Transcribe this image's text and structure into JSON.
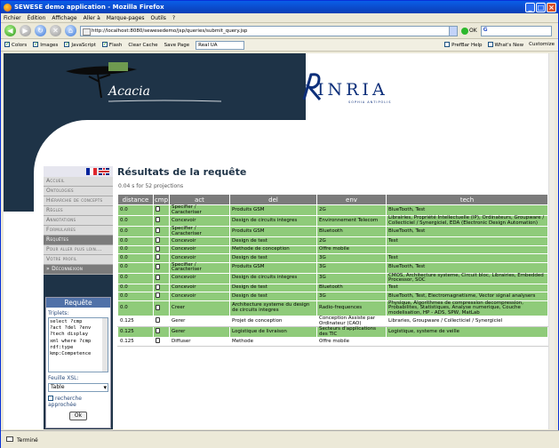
{
  "window": {
    "title": "SEWESE demo application - Mozilla Firefox"
  },
  "menu": [
    "Fichier",
    "Édition",
    "Affichage",
    "Aller à",
    "Marque-pages",
    "Outils",
    "?"
  ],
  "nav": {
    "url": "http://localhost:8080/sewesedemo/jsp/queries/submit_query.jsp",
    "go": "OK",
    "search_value": "G"
  },
  "webdev": {
    "colors": "Colors",
    "images": "Images",
    "javascript": "JavaScript",
    "flash": "Flash",
    "clear_cache": "Clear Cache",
    "save_page": "Save Page",
    "ua_select": "Real UA",
    "prefbar_help": "PrefBar Help",
    "whats_new": "What's New",
    "customize": "Customize"
  },
  "header": {
    "acacia": "Acacia",
    "inria": "INRIA",
    "inria_sub": "SOPHIA ANTIPOLIS"
  },
  "sidebar": {
    "items": [
      "Accueil",
      "Ontologies",
      "Hiérarchie de concepts",
      "Règles",
      "Annotations",
      "Formulaires",
      "Requêtes",
      "Pour aller plus loin...",
      "Votre profil",
      "» Déconnexion"
    ],
    "request_title": "Requête",
    "triplets_label": "Triplets:",
    "triplets": "select ?cmp\n?act ?del ?env\n?tech display\nxml where ?cmp\nrdf:type\nkmp:Competence",
    "xsl_label": "Feuille XSL:",
    "xsl_value": "Table",
    "approx_label": "recherche approchée",
    "ok": "Ok"
  },
  "main": {
    "title": "Résultats de la requête",
    "time": "0.04 s for 52 projections",
    "headers": [
      "distance",
      "cmp",
      "act",
      "del",
      "env",
      "tech"
    ],
    "rows": [
      {
        "c": "g",
        "d": "0.0",
        "act": "Specifier / Caracteriser",
        "del": "Produits GSM",
        "env": "2G",
        "tech": "BlueTooth, Test"
      },
      {
        "c": "g",
        "d": "0.0",
        "act": "Concevoir",
        "del": "Design de circuits integres",
        "env": "Environnement Telecom",
        "tech": "Librairies, Propriété Intellectuelle (IP), Ordinateurs, Groupware / Collecticiel / Synergiciel, EDA (Electronic Design Automation)"
      },
      {
        "c": "g",
        "d": "0.0",
        "act": "Specifier / Caracteriser",
        "del": "Produits GSM",
        "env": "Bluetooth",
        "tech": "BlueTooth, Test"
      },
      {
        "c": "g",
        "d": "0.0",
        "act": "Concevoir",
        "del": "Design de test",
        "env": "2G",
        "tech": "Test"
      },
      {
        "c": "g",
        "d": "0.0",
        "act": "Concevoir",
        "del": "Methode de conception",
        "env": "Offre mobile",
        "tech": ""
      },
      {
        "c": "g",
        "d": "0.0",
        "act": "Concevoir",
        "del": "Design de test",
        "env": "3G",
        "tech": "Test"
      },
      {
        "c": "g",
        "d": "0.0",
        "act": "Specifier / Caracteriser",
        "del": "Produits GSM",
        "env": "3G",
        "tech": "BlueTooth, Test"
      },
      {
        "c": "g",
        "d": "0.0",
        "act": "Concevoir",
        "del": "Design de circuits integres",
        "env": "3G",
        "tech": "CMOS, Architecture systeme, Circuit bloc, Librairies, Embedded Processor, SOC"
      },
      {
        "c": "g",
        "d": "0.0",
        "act": "Concevoir",
        "del": "Design de test",
        "env": "Bluetooth",
        "tech": "Test"
      },
      {
        "c": "g",
        "d": "0.0",
        "act": "Concevoir",
        "del": "Design de test",
        "env": "3G",
        "tech": "BlueTooth, Test, Electromagnetisme, Vector signal analysers"
      },
      {
        "c": "g",
        "d": "0.0",
        "act": "Creer",
        "del": "Architecture systeme du design de circuits integres",
        "env": "Radio-frequences",
        "tech": "Physique, Algorithmes de compression decompression, Probabilites, Statistiques, Analyse numerique, Couche modelisation, HP - ADS, SPW, MatLab"
      },
      {
        "c": "w",
        "d": "0.125",
        "act": "Gerer",
        "del": "Projet de conception",
        "env": "Conception Assiste par Ordinateur (CAO)",
        "tech": "Libraries, Groupware / Collecticiel / Synergiciel"
      },
      {
        "c": "g",
        "d": "0.125",
        "act": "Gerer",
        "del": "Logistique de livraison",
        "env": "Secteurs d'applications des TIC",
        "tech": "Logistique, systeme de veille"
      },
      {
        "c": "w",
        "d": "0.125",
        "act": "Diffuser",
        "del": "Methode",
        "env": "Offre mobile",
        "tech": ""
      }
    ]
  },
  "status": {
    "text": "Terminé"
  }
}
